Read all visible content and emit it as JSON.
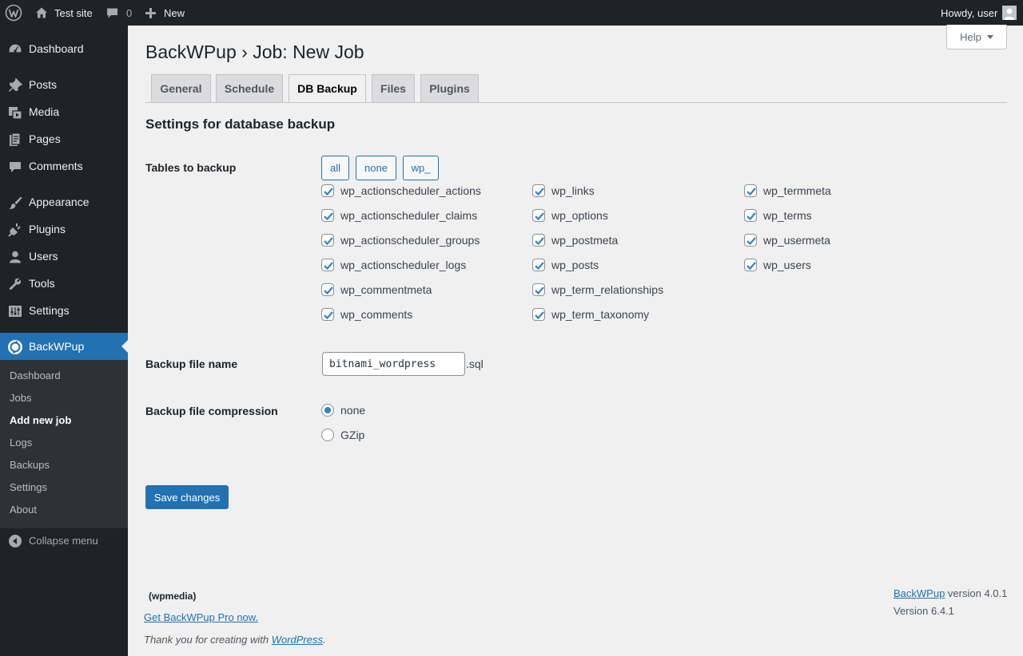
{
  "admin_bar": {
    "site_name": "Test site",
    "comments_count": "0",
    "new_label": "New",
    "howdy": "Howdy, user"
  },
  "sidebar": {
    "items": [
      {
        "label": "Dashboard",
        "icon": "dashboard-icon"
      },
      {
        "label": "Posts",
        "icon": "pushpin-icon"
      },
      {
        "label": "Media",
        "icon": "media-icon"
      },
      {
        "label": "Pages",
        "icon": "pages-icon"
      },
      {
        "label": "Comments",
        "icon": "comment-icon"
      },
      {
        "label": "Appearance",
        "icon": "paintbrush-icon"
      },
      {
        "label": "Plugins",
        "icon": "plugin-icon"
      },
      {
        "label": "Users",
        "icon": "users-icon"
      },
      {
        "label": "Tools",
        "icon": "wrench-icon"
      },
      {
        "label": "Settings",
        "icon": "settings-icon"
      },
      {
        "label": "BackWPup",
        "icon": "backwpup-icon"
      }
    ],
    "submenu": [
      "Dashboard",
      "Jobs",
      "Add new job",
      "Logs",
      "Backups",
      "Settings",
      "About"
    ],
    "collapse_label": "Collapse menu"
  },
  "help_label": "Help",
  "page_title": "BackWPup › Job: New Job",
  "tabs": [
    "General",
    "Schedule",
    "DB Backup",
    "Files",
    "Plugins"
  ],
  "active_tab": "DB Backup",
  "section_title": "Settings for database backup",
  "tables_label": "Tables to backup",
  "select_buttons": [
    "all",
    "none",
    "wp_"
  ],
  "tables": {
    "col1": [
      "wp_actionscheduler_actions",
      "wp_actionscheduler_claims",
      "wp_actionscheduler_groups",
      "wp_actionscheduler_logs",
      "wp_commentmeta",
      "wp_comments"
    ],
    "col2": [
      "wp_links",
      "wp_options",
      "wp_postmeta",
      "wp_posts",
      "wp_term_relationships",
      "wp_term_taxonomy"
    ],
    "col3": [
      "wp_termmeta",
      "wp_terms",
      "wp_usermeta",
      "wp_users"
    ]
  },
  "filename_label": "Backup file name",
  "filename_value": "bitnami_wordpress",
  "filename_ext": ".sql",
  "compression_label": "Backup file compression",
  "compression_options": [
    "none",
    "GZip"
  ],
  "compression_selected": "none",
  "save_label": "Save changes",
  "footer": {
    "logo_text": "(wpmedia)",
    "pro_link": "Get BackWPup Pro now.",
    "thanks_prefix": "Thank you for creating with ",
    "thanks_link": "WordPress",
    "thanks_suffix": ".",
    "plugin_link": "BackWPup",
    "plugin_version": " version 4.0.1",
    "wp_version": "Version 6.4.1"
  },
  "colors": {
    "admin_bg": "#1d2327",
    "accent": "#2271b1",
    "page_bg": "#f0f0f1"
  }
}
